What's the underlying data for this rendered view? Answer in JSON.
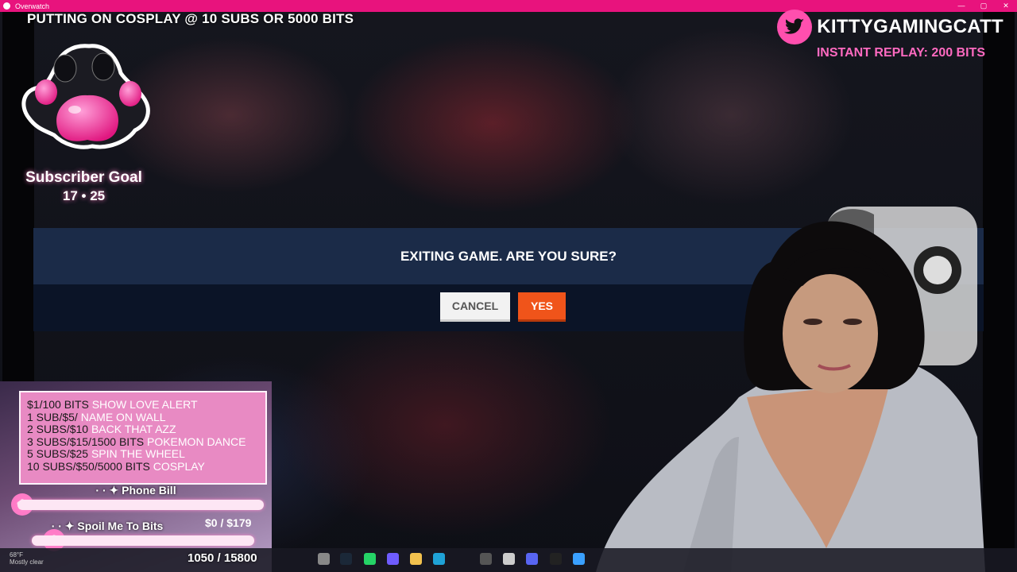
{
  "window": {
    "title": "Overwatch"
  },
  "overlay": {
    "top_banner": "PUTTING ON COSPLAY @ 10 SUBS OR 5000 BITS",
    "twitter_handle": "KITTYGAMINGCATT",
    "instant_replay": "INSTANT REPLAY: 200 BITS",
    "sub_goal_title": "Subscriber Goal",
    "sub_goal_value": "17 • 25",
    "menu_rows": [
      {
        "price": "$1/100 BITS",
        "action": "SHOW LOVE ALERT"
      },
      {
        "price": "1 SUB/$5/",
        "action": "NAME ON WALL"
      },
      {
        "price": "2 SUBS/$10",
        "action": "BACK THAT AZZ"
      },
      {
        "price": "3 SUBS/$15/1500 BITS",
        "action": "POKEMON DANCE"
      },
      {
        "price": "5 SUBS/$25",
        "action": "SPIN THE WHEEL"
      },
      {
        "price": "10 SUBS/$50/5000 BITS",
        "action": "COSPLAY"
      }
    ],
    "phone_bill_label": "· · ✦ Phone Bill",
    "spoil_label": "· · ✦ Spoil Me To Bits",
    "spoil_amount": "$0 / $179",
    "bits_counter": "1050 / 15800",
    "weather_temp": "68°F",
    "weather_desc": "Mostly clear",
    "colors": {
      "accent": "#e8137d",
      "pink": "#ff6ac1",
      "yes": "#f0541a",
      "dialog_head": "#1b2b48"
    }
  },
  "dialog": {
    "message": "EXITING GAME. ARE YOU SURE?",
    "cancel_label": "CANCEL",
    "yes_label": "YES"
  }
}
